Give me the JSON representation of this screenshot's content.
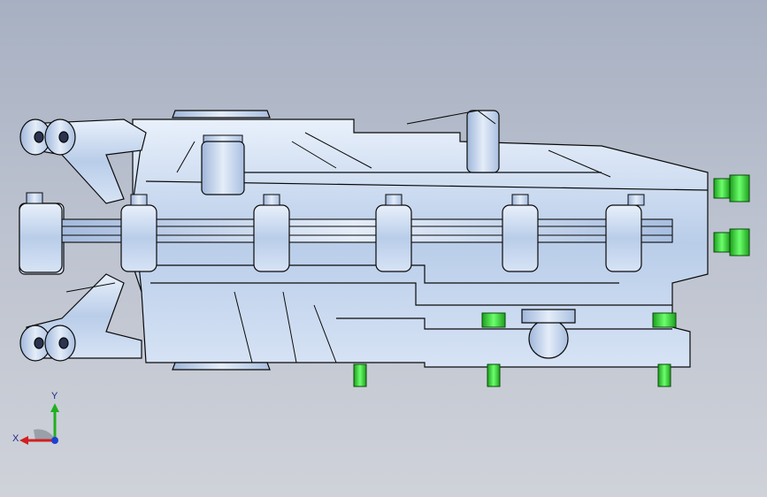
{
  "viewport": {
    "background_top": "#a7b0c2",
    "background_bottom": "#cfd2d9"
  },
  "model": {
    "part_color": "#c2d5ef",
    "edge_color": "#0a0a0a",
    "fastener_color": "#33cc33",
    "fastener_icon": "hex-bolt-icon"
  },
  "triad": {
    "x_label": "X",
    "y_label": "Y",
    "x_color": "#d21f1f",
    "y_color": "#1fb01f",
    "z_color": "#1f3fd2"
  }
}
